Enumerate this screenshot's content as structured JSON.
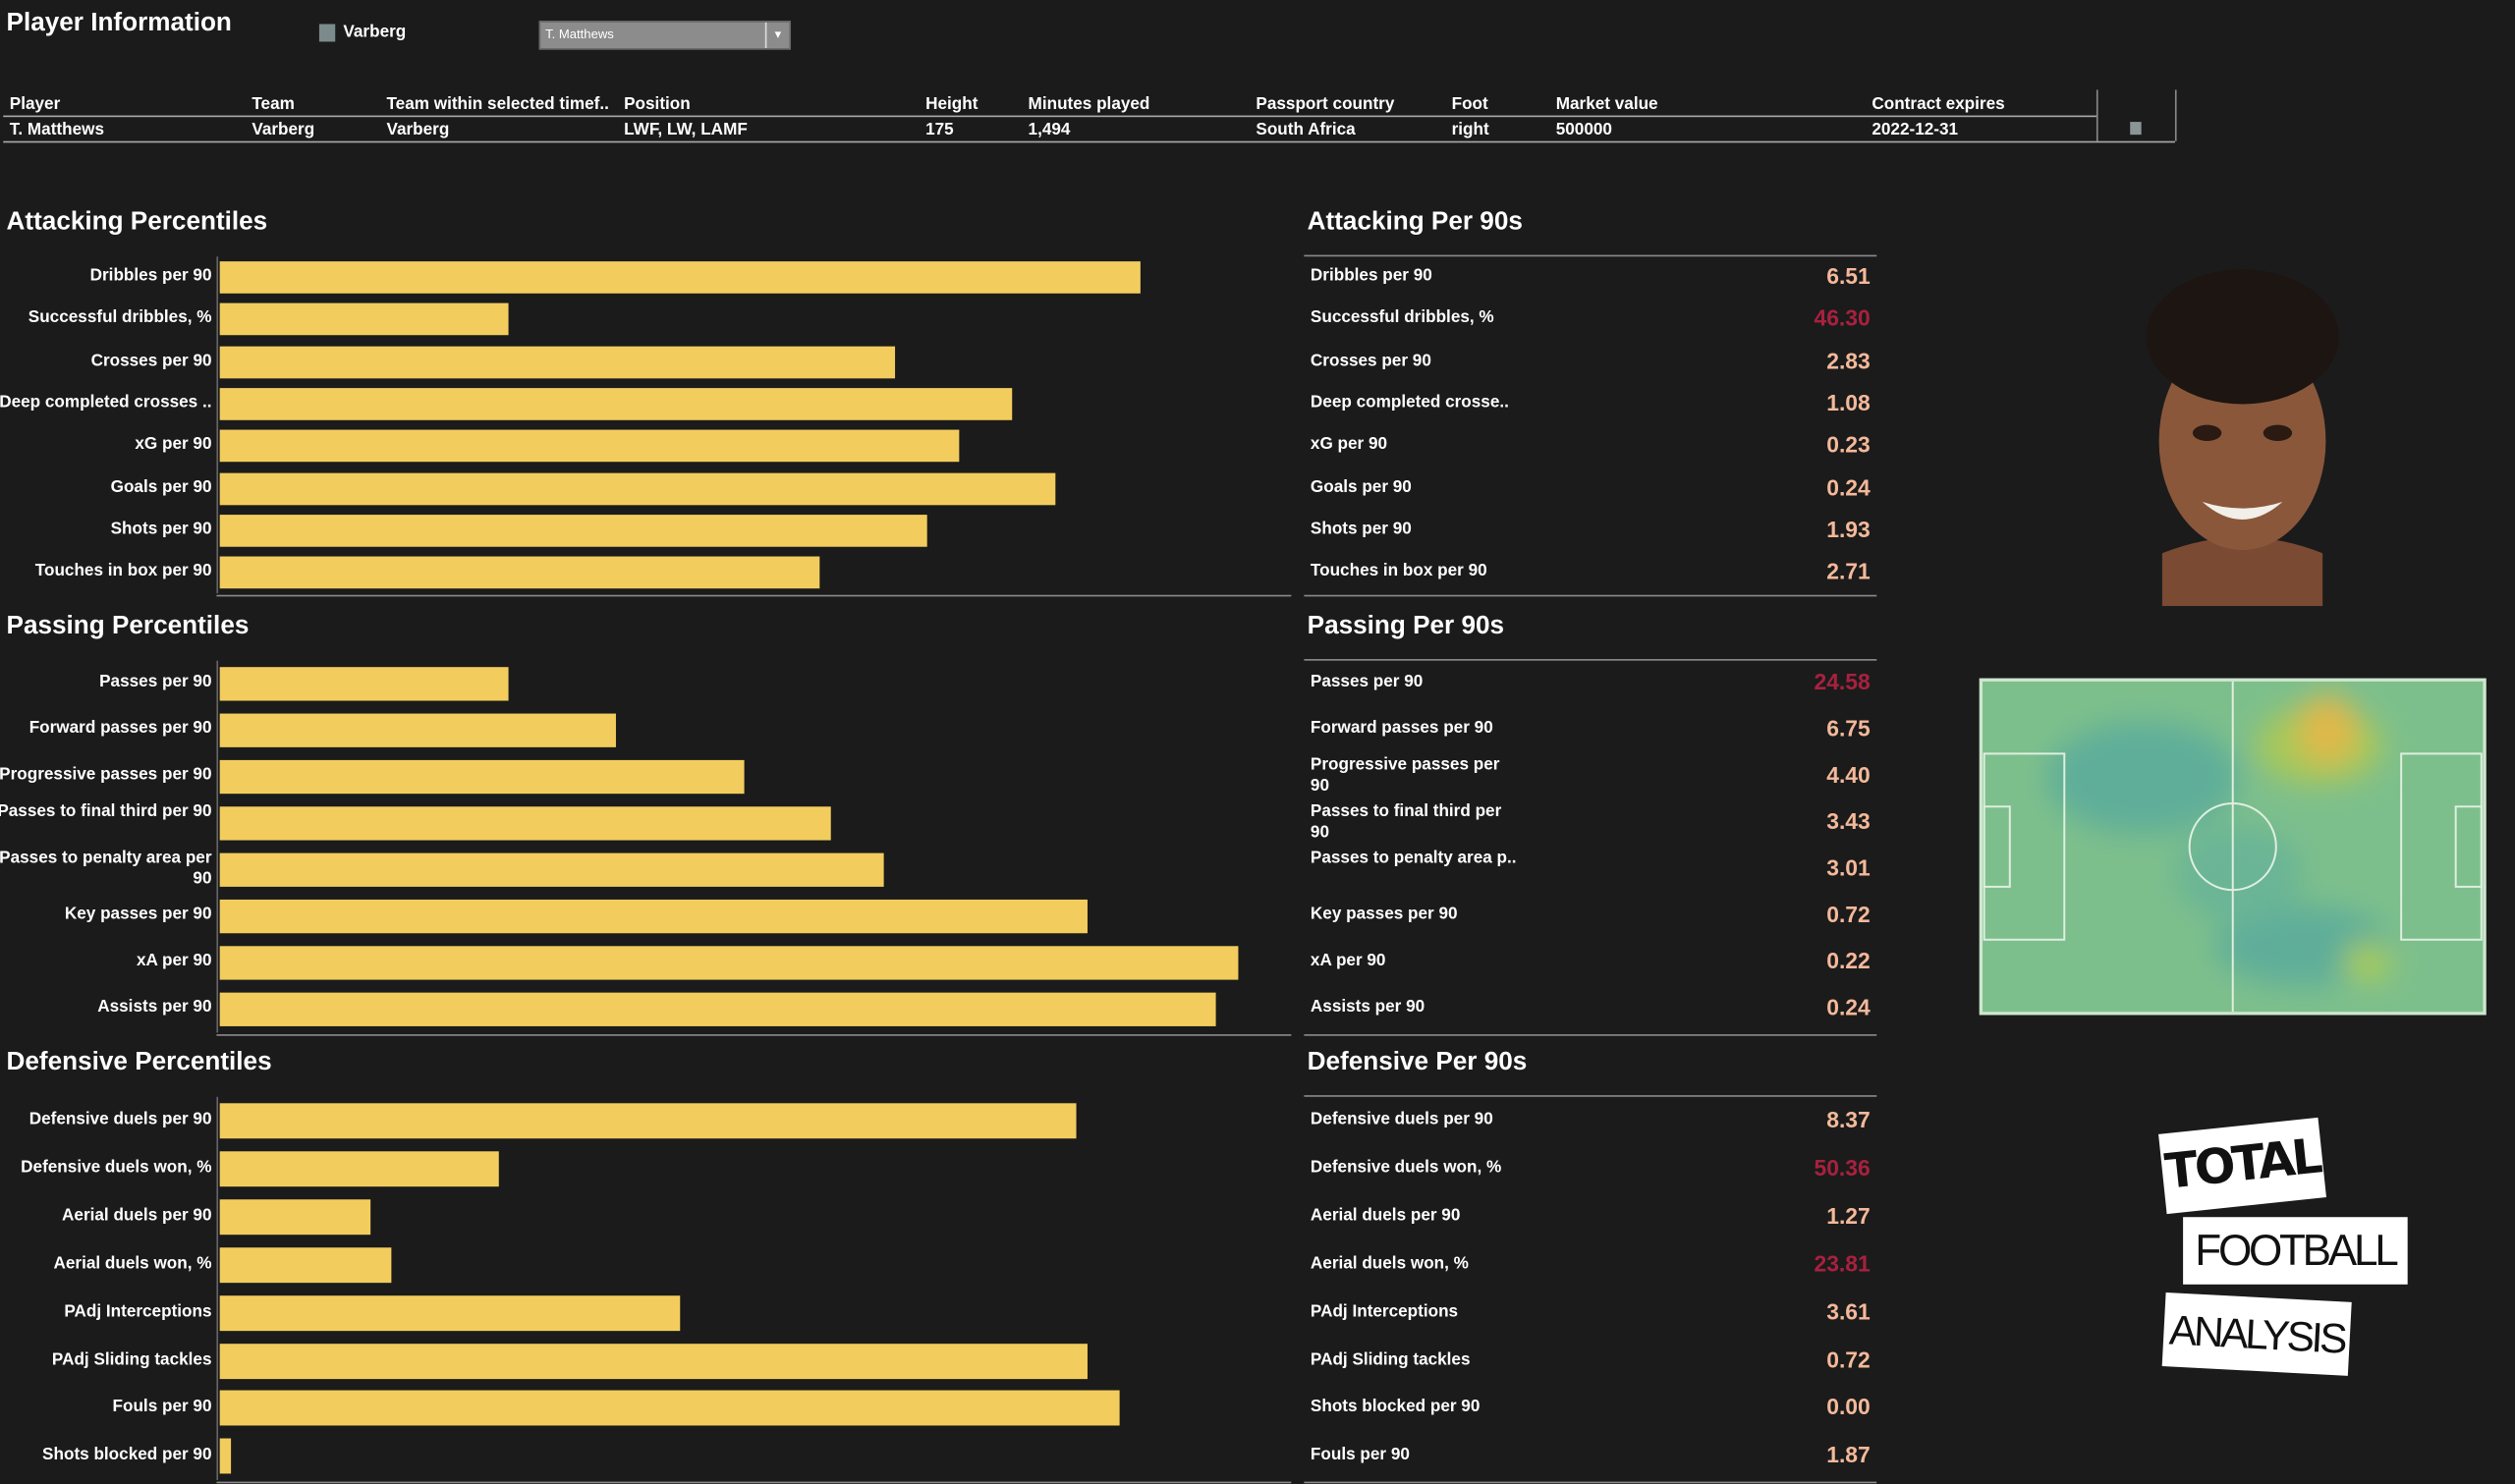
{
  "header": {
    "title": "Player Information",
    "legend_team": "Varberg",
    "legend_color": "#7b8a8a",
    "player_select": "T. Matthews"
  },
  "info_table": {
    "columns": [
      "Player",
      "Team",
      "Team within selected timef..",
      "Position",
      "Height",
      "Minutes played",
      "Passport country",
      "Foot",
      "Market value",
      "Contract expires"
    ],
    "row": [
      "T. Matthews",
      "Varberg",
      "Varberg",
      "LWF, LW, LAMF",
      "175",
      "1,494",
      "South Africa",
      "right",
      "500000",
      "2022-12-31"
    ]
  },
  "colors": {
    "bar": "#f2cd5e",
    "value_normal": "#f4b99a",
    "value_low": "#a8213f"
  },
  "chart_data": [
    {
      "type": "bar",
      "orientation": "horizontal",
      "title": "Attacking Percentiles",
      "xlim": [
        0,
        100
      ],
      "categories": [
        "Dribbles per 90",
        "Successful dribbles, %",
        "Crosses per 90",
        "Deep completed crosses ..",
        "xG per 90",
        "Goals per 90",
        "Shots per 90",
        "Touches in box per 90"
      ],
      "values": [
        86,
        27,
        63,
        74,
        69,
        78,
        66,
        56
      ]
    },
    {
      "type": "bar",
      "orientation": "horizontal",
      "title": "Passing Percentiles",
      "xlim": [
        0,
        100
      ],
      "categories": [
        "Passes per 90",
        "Forward passes per 90",
        "Progressive passes per 90",
        "Passes to final third per 90",
        "Passes to penalty area per 90",
        "Key passes per 90",
        "xA per 90",
        "Assists per 90"
      ],
      "values": [
        27,
        37,
        49,
        57,
        62,
        81,
        95,
        93
      ]
    },
    {
      "type": "bar",
      "orientation": "horizontal",
      "title": "Defensive Percentiles",
      "xlim": [
        0,
        100
      ],
      "categories": [
        "Defensive duels per 90",
        "Defensive duels won, %",
        "Aerial duels per 90",
        "Aerial duels won, %",
        "PAdj Interceptions",
        "PAdj Sliding tackles",
        "Fouls per 90",
        "Shots blocked per 90"
      ],
      "values": [
        80,
        26,
        14,
        16,
        43,
        81,
        84,
        1
      ]
    }
  ],
  "per90": [
    {
      "title": "Attacking Per 90s",
      "rows": [
        [
          "Dribbles per 90",
          "6.51",
          0
        ],
        [
          "Successful dribbles, %",
          "46.30",
          1
        ],
        [
          "Crosses per 90",
          "2.83",
          0
        ],
        [
          "Deep completed crosse..",
          "1.08",
          0
        ],
        [
          "xG per 90",
          "0.23",
          0
        ],
        [
          "Goals per 90",
          "0.24",
          0
        ],
        [
          "Shots per 90",
          "1.93",
          0
        ],
        [
          "Touches in box per 90",
          "2.71",
          0
        ]
      ]
    },
    {
      "title": "Passing Per 90s",
      "rows": [
        [
          "Passes per 90",
          "24.58",
          1
        ],
        [
          "Forward passes per 90",
          "6.75",
          0
        ],
        [
          "Progressive passes per 90",
          "4.40",
          0
        ],
        [
          "Passes to final third per 90",
          "3.43",
          0
        ],
        [
          "Passes to penalty area p..",
          "3.01",
          0
        ],
        [
          "Key passes per 90",
          "0.72",
          0
        ],
        [
          "xA per 90",
          "0.22",
          0
        ],
        [
          "Assists per 90",
          "0.24",
          0
        ]
      ]
    },
    {
      "title": "Defensive Per 90s",
      "rows": [
        [
          "Defensive duels per 90",
          "8.37",
          0
        ],
        [
          "Defensive duels won, %",
          "50.36",
          1
        ],
        [
          "Aerial duels per 90",
          "1.27",
          0
        ],
        [
          "Aerial duels won, %",
          "23.81",
          1
        ],
        [
          "PAdj Interceptions",
          "3.61",
          0
        ],
        [
          "PAdj Sliding tackles",
          "0.72",
          0
        ],
        [
          "Shots blocked per 90",
          "0.00",
          0
        ],
        [
          "Fouls per 90",
          "1.87",
          0
        ]
      ]
    }
  ],
  "logo": {
    "lines": [
      "TOTAL",
      "FOOTBALL",
      "ANALYSIS"
    ]
  }
}
